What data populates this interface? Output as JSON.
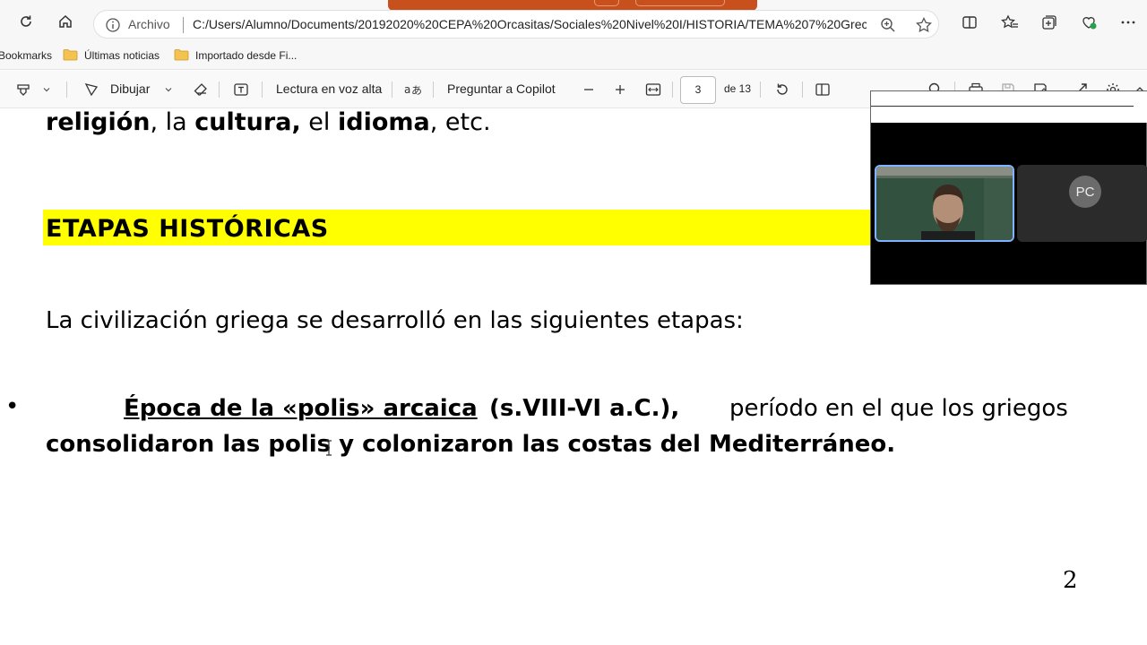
{
  "browser": {
    "address": {
      "scheme_label": "Archivo",
      "url": "C:/Users/Alumno/Documents/20192020%20CEPA%20Orcasitas/Sociales%20Nivel%20I/HISTORIA/TEMA%207%20Grecia...."
    },
    "bookmarks": [
      {
        "label": "Bookmarks"
      },
      {
        "label": "Últimas noticias"
      },
      {
        "label": "Importado desde Fi..."
      }
    ]
  },
  "pdf_toolbar": {
    "draw_label": "Dibujar",
    "read_aloud_label": "Lectura en voz alta",
    "copilot_label": "Preguntar a Copilot",
    "page_current": "3",
    "page_total": "de 13"
  },
  "document": {
    "line1": {
      "w1": "religión",
      "t1": ", la ",
      "w2": "cultura,",
      "t2": " el ",
      "w3": "idioma",
      "t3": ", etc."
    },
    "heading": "ETAPAS HISTÓRICAS",
    "intro": "La civilización griega se desarrolló en las siguientes etapas:",
    "bullet1": {
      "title": "Época de la «polis» arcaica ",
      "dates": "(s.VIII-VI a.C.),",
      "rest": "período en el que los griegos",
      "cont": "consolidaron las polis y colonizaron las costas del Mediterráneo."
    },
    "page_number": "2"
  },
  "video_call": {
    "participant_initials": "PC"
  },
  "colors": {
    "highlight": "#ffff00",
    "accent_tab": "#c8501c",
    "active_tile_border": "#7fb3ff"
  }
}
